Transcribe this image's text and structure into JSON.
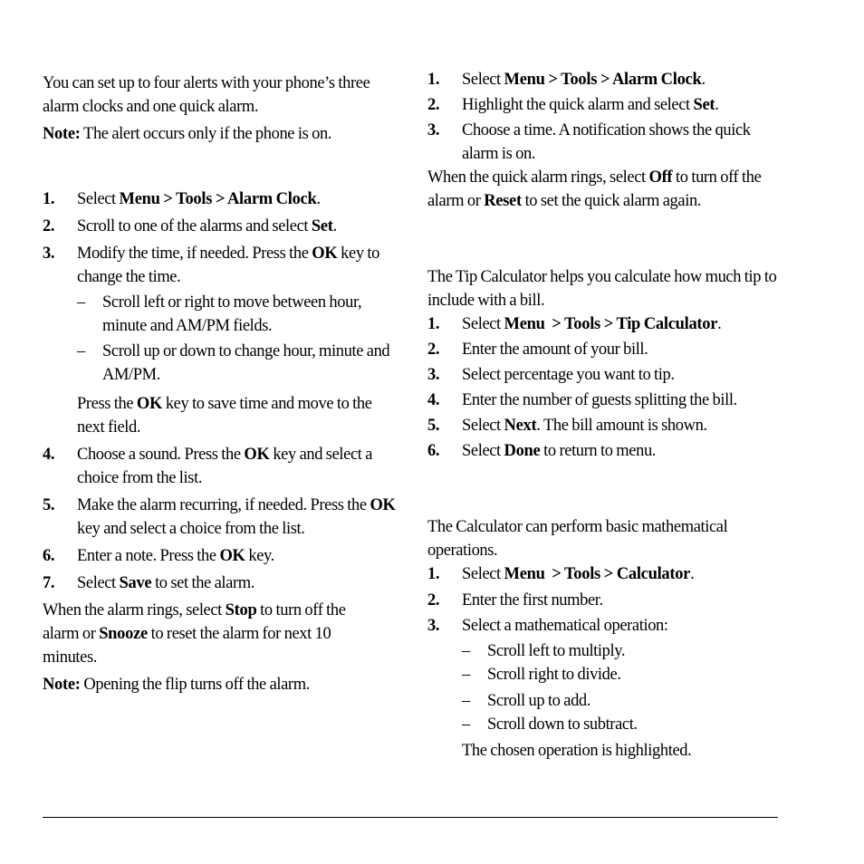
{
  "left_column": {
    "intro": "You can set up to four alerts with your phone’s three alarm clocks and one quick alarm.",
    "note1": {
      "label": "Note:",
      "text": " The alert occurs only if the phone is on."
    },
    "steps": [
      {
        "num": "1.",
        "pre": "Select ",
        "bold": "Menu > Tools > Alarm Clock",
        "post": "."
      },
      {
        "num": "2.",
        "pre": "Scroll to one of the alarms and select ",
        "bold": "Set",
        "post": "."
      },
      {
        "num": "3.",
        "pre": "Modify the time, if needed. Press the ",
        "bold": "OK",
        "post": " key to change the time."
      },
      {
        "num": "4.",
        "pre": "Choose a sound. Press the ",
        "bold": "OK",
        "post": " key and select a choice from the list."
      },
      {
        "num": "5.",
        "pre": "Make the alarm recurring, if needed. Press the ",
        "bold": "OK",
        "post": " key and select a choice from the list."
      },
      {
        "num": "6.",
        "pre": "Enter a note. Press the ",
        "bold": "OK",
        "post": " key."
      },
      {
        "num": "7.",
        "pre": "Select ",
        "bold": "Save",
        "post": " to set the alarm."
      }
    ],
    "step3_subitems": [
      {
        "dash": "–",
        "text": "Scroll left or right to move between hour, minute and AM/PM fields."
      },
      {
        "dash": "–",
        "text": "Scroll up or down to change hour, minute and AM/PM."
      }
    ],
    "step3_followup": {
      "pre": "Press the ",
      "bold": "OK",
      "post": " key to save time and move to the next field."
    },
    "rings": {
      "pre": "When the alarm rings, select ",
      "bold1": "Stop",
      "mid": " to turn off the alarm or ",
      "bold2": "Snooze",
      "post": " to reset the alarm for next 10 minutes."
    },
    "note2": {
      "label": "Note:",
      "text": " Opening the flip turns off the alarm."
    }
  },
  "right_column": {
    "quick_steps": [
      {
        "num": "1.",
        "pre": "Select ",
        "bold": "Menu > Tools > Alarm Clock",
        "post": "."
      },
      {
        "num": "2.",
        "pre": "Highlight the quick alarm and select ",
        "bold": "Set",
        "post": "."
      },
      {
        "num": "3.",
        "pre": "Choose a time. A notification shows the quick alarm is on.",
        "bold": "",
        "post": ""
      }
    ],
    "quick_rings": {
      "pre": "When the quick alarm rings, select ",
      "bold1": "Off",
      "mid": " to turn off the alarm or ",
      "bold2": "Reset",
      "post": " to set the quick alarm again."
    },
    "tip_intro": "The Tip Calculator helps you calculate how much tip to include with a bill.",
    "tip_steps": [
      {
        "num": "1.",
        "pre": "Select ",
        "bold": "Menu  > Tools > Tip Calculator",
        "post": "."
      },
      {
        "num": "2.",
        "pre": "Enter the amount of your bill.",
        "bold": "",
        "post": ""
      },
      {
        "num": "3.",
        "pre": "Select percentage you want to tip.",
        "bold": "",
        "post": ""
      },
      {
        "num": "4.",
        "pre": "Enter the number of guests splitting the bill.",
        "bold": "",
        "post": ""
      },
      {
        "num": "5.",
        "pre": "Select ",
        "bold": "Next",
        "post": ". The bill amount is shown."
      },
      {
        "num": "6.",
        "pre": "Select ",
        "bold": "Done",
        "post": " to return to menu."
      }
    ],
    "calc_intro": "The Calculator can perform basic mathematical operations.",
    "calc_steps": [
      {
        "num": "1.",
        "pre": "Select ",
        "bold": "Menu  > Tools > Calculator",
        "post": "."
      },
      {
        "num": "2.",
        "pre": "Enter the first number.",
        "bold": "",
        "post": ""
      },
      {
        "num": "3.",
        "pre": "Select a mathematical operation:",
        "bold": "",
        "post": ""
      }
    ],
    "calc_subitems": [
      {
        "dash": "–",
        "text": "Scroll left to multiply."
      },
      {
        "dash": "–",
        "text": "Scroll right to divide."
      },
      {
        "dash": "–",
        "text": "Scroll up to add."
      },
      {
        "dash": "–",
        "text": "Scroll down to subtract."
      }
    ],
    "calc_followup": "The chosen operation is highlighted."
  }
}
